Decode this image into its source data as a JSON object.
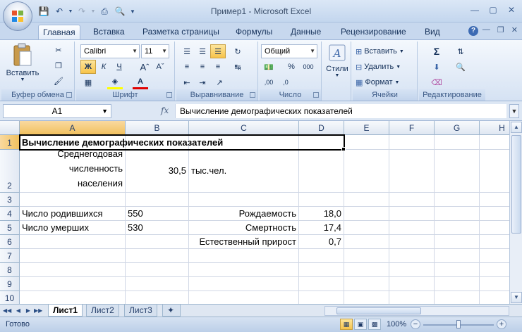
{
  "window": {
    "title": "Пример1 - Microsoft Excel"
  },
  "ribbon_tabs": [
    "Главная",
    "Вставка",
    "Разметка страницы",
    "Формулы",
    "Данные",
    "Рецензирование",
    "Вид"
  ],
  "ribbon": {
    "clipboard": {
      "label": "Буфер обмена",
      "paste": "Вставить"
    },
    "font": {
      "label": "Шрифт",
      "name": "Calibri",
      "size": "11"
    },
    "alignment": {
      "label": "Выравнивание"
    },
    "number": {
      "label": "Число",
      "format": "Общий"
    },
    "styles": {
      "label": "Стили"
    },
    "cells": {
      "label": "Ячейки",
      "insert": "Вставить",
      "delete": "Удалить",
      "format": "Формат"
    },
    "editing": {
      "label": "Редактирование"
    }
  },
  "formula_bar": {
    "name_box": "A1",
    "fx": "fx",
    "content": "Вычисление демографических показателей"
  },
  "columns": [
    "A",
    "B",
    "C",
    "D",
    "E",
    "F",
    "G",
    "H"
  ],
  "rows": [
    "1",
    "2",
    "3",
    "4",
    "5",
    "6",
    "7",
    "8",
    "9",
    "10"
  ],
  "cells": {
    "A1": "Вычисление демографических показателей",
    "A2": "Среднегодовая численность населения",
    "B2": "30,5",
    "C2": "тыс.чел.",
    "A4": "Число родившихся",
    "B4": "550",
    "C4": "Рождаемость",
    "D4": "18,0",
    "A5": "Число умерших",
    "B5": "530",
    "C5": "Смертность",
    "D5": "17,4",
    "C6": "Естественный прирост",
    "D6": "0,7"
  },
  "sheets": [
    "Лист1",
    "Лист2",
    "Лист3"
  ],
  "active_sheet": "Лист1",
  "status": {
    "text": "Готово",
    "zoom": "100%"
  }
}
